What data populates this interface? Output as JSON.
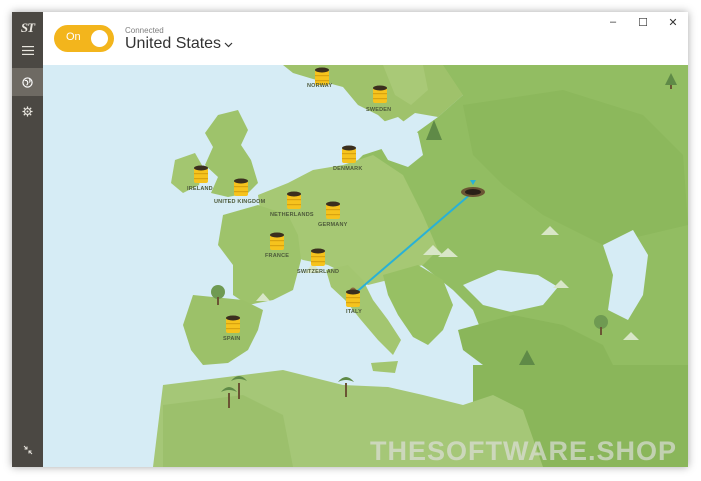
{
  "app": {
    "logo_text": "ST",
    "toggle_label": "On",
    "connection_status": "Connected",
    "selected_country": "United States",
    "window_controls": {
      "minimize": "–",
      "maximize": "☐",
      "close": "✕"
    }
  },
  "sidebar": {
    "items": [
      {
        "icon": "hamburger-menu-icon"
      },
      {
        "icon": "globe-icon",
        "active": true
      },
      {
        "icon": "gear-icon"
      }
    ],
    "bottom_icon": "compress-arrows-icon"
  },
  "map": {
    "locations": [
      "NORWAY",
      "SWEDEN",
      "DENMARK",
      "IRELAND",
      "UNITED KINGDOM",
      "NETHERLANDS",
      "GERMANY",
      "FRANCE",
      "SWITZERLAND",
      "ITALY",
      "SPAIN"
    ],
    "connected_location": "ITALY",
    "tunnel_color": "#29b1d6",
    "barrel_color": "#f6c31d"
  },
  "watermark": "THESOFTWARE.SHOP"
}
